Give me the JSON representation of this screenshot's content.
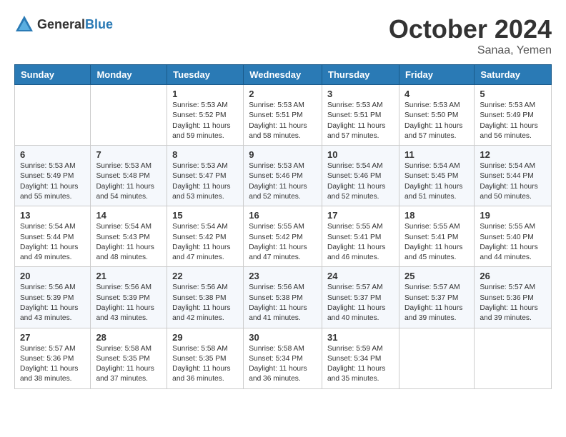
{
  "header": {
    "logo_general": "General",
    "logo_blue": "Blue",
    "month": "October 2024",
    "location": "Sanaa, Yemen"
  },
  "weekdays": [
    "Sunday",
    "Monday",
    "Tuesday",
    "Wednesday",
    "Thursday",
    "Friday",
    "Saturday"
  ],
  "weeks": [
    [
      {
        "day": "",
        "info": ""
      },
      {
        "day": "",
        "info": ""
      },
      {
        "day": "1",
        "info": "Sunrise: 5:53 AM\nSunset: 5:52 PM\nDaylight: 11 hours and 59 minutes."
      },
      {
        "day": "2",
        "info": "Sunrise: 5:53 AM\nSunset: 5:51 PM\nDaylight: 11 hours and 58 minutes."
      },
      {
        "day": "3",
        "info": "Sunrise: 5:53 AM\nSunset: 5:51 PM\nDaylight: 11 hours and 57 minutes."
      },
      {
        "day": "4",
        "info": "Sunrise: 5:53 AM\nSunset: 5:50 PM\nDaylight: 11 hours and 57 minutes."
      },
      {
        "day": "5",
        "info": "Sunrise: 5:53 AM\nSunset: 5:49 PM\nDaylight: 11 hours and 56 minutes."
      }
    ],
    [
      {
        "day": "6",
        "info": "Sunrise: 5:53 AM\nSunset: 5:49 PM\nDaylight: 11 hours and 55 minutes."
      },
      {
        "day": "7",
        "info": "Sunrise: 5:53 AM\nSunset: 5:48 PM\nDaylight: 11 hours and 54 minutes."
      },
      {
        "day": "8",
        "info": "Sunrise: 5:53 AM\nSunset: 5:47 PM\nDaylight: 11 hours and 53 minutes."
      },
      {
        "day": "9",
        "info": "Sunrise: 5:53 AM\nSunset: 5:46 PM\nDaylight: 11 hours and 52 minutes."
      },
      {
        "day": "10",
        "info": "Sunrise: 5:54 AM\nSunset: 5:46 PM\nDaylight: 11 hours and 52 minutes."
      },
      {
        "day": "11",
        "info": "Sunrise: 5:54 AM\nSunset: 5:45 PM\nDaylight: 11 hours and 51 minutes."
      },
      {
        "day": "12",
        "info": "Sunrise: 5:54 AM\nSunset: 5:44 PM\nDaylight: 11 hours and 50 minutes."
      }
    ],
    [
      {
        "day": "13",
        "info": "Sunrise: 5:54 AM\nSunset: 5:44 PM\nDaylight: 11 hours and 49 minutes."
      },
      {
        "day": "14",
        "info": "Sunrise: 5:54 AM\nSunset: 5:43 PM\nDaylight: 11 hours and 48 minutes."
      },
      {
        "day": "15",
        "info": "Sunrise: 5:54 AM\nSunset: 5:42 PM\nDaylight: 11 hours and 47 minutes."
      },
      {
        "day": "16",
        "info": "Sunrise: 5:55 AM\nSunset: 5:42 PM\nDaylight: 11 hours and 47 minutes."
      },
      {
        "day": "17",
        "info": "Sunrise: 5:55 AM\nSunset: 5:41 PM\nDaylight: 11 hours and 46 minutes."
      },
      {
        "day": "18",
        "info": "Sunrise: 5:55 AM\nSunset: 5:41 PM\nDaylight: 11 hours and 45 minutes."
      },
      {
        "day": "19",
        "info": "Sunrise: 5:55 AM\nSunset: 5:40 PM\nDaylight: 11 hours and 44 minutes."
      }
    ],
    [
      {
        "day": "20",
        "info": "Sunrise: 5:56 AM\nSunset: 5:39 PM\nDaylight: 11 hours and 43 minutes."
      },
      {
        "day": "21",
        "info": "Sunrise: 5:56 AM\nSunset: 5:39 PM\nDaylight: 11 hours and 43 minutes."
      },
      {
        "day": "22",
        "info": "Sunrise: 5:56 AM\nSunset: 5:38 PM\nDaylight: 11 hours and 42 minutes."
      },
      {
        "day": "23",
        "info": "Sunrise: 5:56 AM\nSunset: 5:38 PM\nDaylight: 11 hours and 41 minutes."
      },
      {
        "day": "24",
        "info": "Sunrise: 5:57 AM\nSunset: 5:37 PM\nDaylight: 11 hours and 40 minutes."
      },
      {
        "day": "25",
        "info": "Sunrise: 5:57 AM\nSunset: 5:37 PM\nDaylight: 11 hours and 39 minutes."
      },
      {
        "day": "26",
        "info": "Sunrise: 5:57 AM\nSunset: 5:36 PM\nDaylight: 11 hours and 39 minutes."
      }
    ],
    [
      {
        "day": "27",
        "info": "Sunrise: 5:57 AM\nSunset: 5:36 PM\nDaylight: 11 hours and 38 minutes."
      },
      {
        "day": "28",
        "info": "Sunrise: 5:58 AM\nSunset: 5:35 PM\nDaylight: 11 hours and 37 minutes."
      },
      {
        "day": "29",
        "info": "Sunrise: 5:58 AM\nSunset: 5:35 PM\nDaylight: 11 hours and 36 minutes."
      },
      {
        "day": "30",
        "info": "Sunrise: 5:58 AM\nSunset: 5:34 PM\nDaylight: 11 hours and 36 minutes."
      },
      {
        "day": "31",
        "info": "Sunrise: 5:59 AM\nSunset: 5:34 PM\nDaylight: 11 hours and 35 minutes."
      },
      {
        "day": "",
        "info": ""
      },
      {
        "day": "",
        "info": ""
      }
    ]
  ]
}
